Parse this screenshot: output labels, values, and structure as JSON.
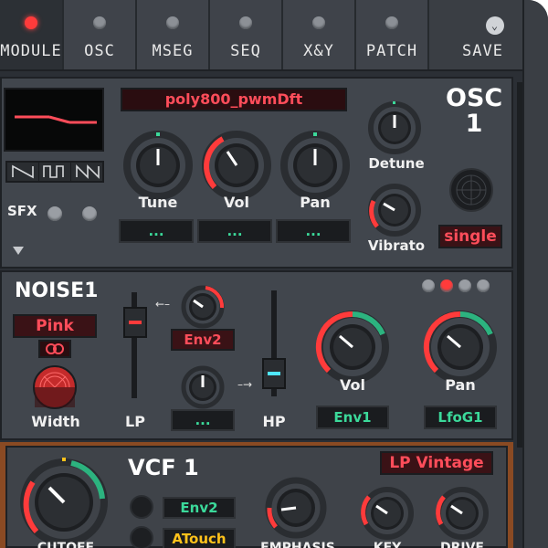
{
  "nav": {
    "tabs": [
      {
        "label": "MODULE",
        "active": true
      },
      {
        "label": "OSC",
        "active": false
      },
      {
        "label": "MSEG",
        "active": false
      },
      {
        "label": "SEQ",
        "active": false
      },
      {
        "label": "X&Y",
        "active": false
      },
      {
        "label": "PATCH",
        "active": false
      }
    ],
    "save_label": "SAVE"
  },
  "osc": {
    "title": "OSC",
    "number": "1",
    "wave_name": "poly800_pwmDft",
    "knobs": {
      "tune": "Tune",
      "vol": "Vol",
      "pan": "Pan",
      "detune": "Detune",
      "vibrato": "Vibrato"
    },
    "mod_slots": [
      "...",
      "...",
      "..."
    ],
    "sfx_label": "SFX",
    "mode": "single"
  },
  "noise": {
    "title": "NOISE1",
    "type": "Pink",
    "width_label": "Width",
    "lp_label": "LP",
    "hp_label": "HP",
    "lp_mod": "Env2",
    "hp_mod": "...",
    "vol_label": "Vol",
    "pan_label": "Pan",
    "vol_mod": "Env1",
    "pan_mod": "LfoG1"
  },
  "vcf": {
    "title": "VCF 1",
    "filter_type": "LP Vintage",
    "mod1": "Env2",
    "mod2": "ATouch",
    "cutoff_label": "CUTOFF",
    "emphasis_label": "EMPHASIS",
    "key_label": "KEY",
    "drive_label": "DRIVE"
  },
  "colors": {
    "accent_red": "#ff4d5a",
    "accent_green": "#3bd99a",
    "accent_yellow": "#ffc21b",
    "panel": "#41464d"
  }
}
